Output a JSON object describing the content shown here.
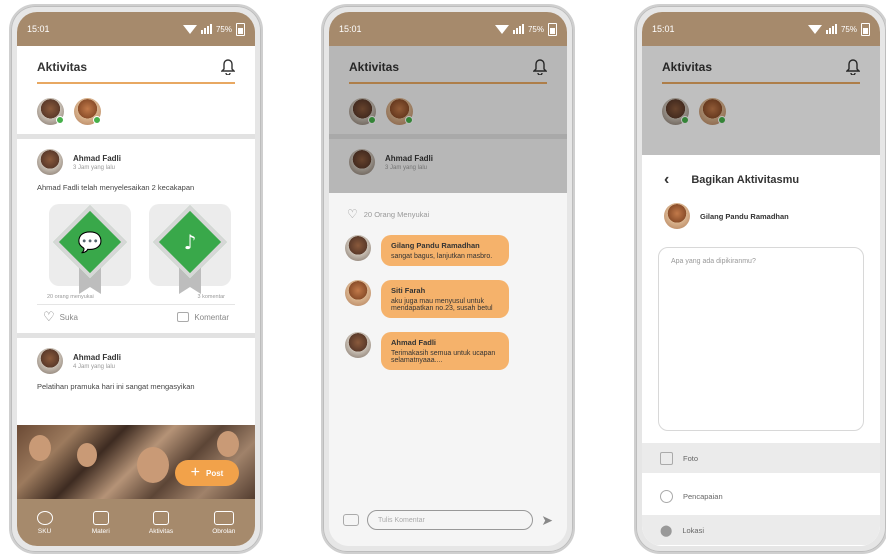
{
  "status": {
    "time": "15:01",
    "battery": "75%"
  },
  "phone1": {
    "title": "Aktivitas",
    "post1": {
      "name": "Ahmad Fadli",
      "time": "3 Jam yang lalu",
      "text": "Ahmad Fadli telah menyelesaikan 2 kecakapan",
      "likes": "20 orang menyukai",
      "comments": "3 komentar"
    },
    "actions": {
      "like": "Suka",
      "comment": "Komentar"
    },
    "post2": {
      "name": "Ahmad Fadli",
      "time": "4 Jam yang lalu",
      "text": "Pelatihan pramuka hari ini sangat mengasyikan"
    },
    "post_button": "Post",
    "nav": [
      "SKU",
      "Materi",
      "Aktivitas",
      "Obrolan"
    ]
  },
  "phone2": {
    "title": "Aktivitas",
    "poster": {
      "name": "Ahmad Fadli",
      "time": "3 Jam yang lalu"
    },
    "likes": "20 Orang Menyukai",
    "comments": [
      {
        "name": "Gilang Pandu Ramadhan",
        "text": "sangat bagus, lanjutkan masbro."
      },
      {
        "name": "Siti Farah",
        "text": "aku juga mau menyusul untuk mendapatkan no.23, susah betul"
      },
      {
        "name": "Ahmad Fadli",
        "text": "Terimakasih semua untuk ucapan selamatnyaaa...."
      }
    ],
    "input_placeholder": "Tulis Komentar"
  },
  "phone3": {
    "title": "Aktivitas",
    "sheet_title": "Bagikan Aktivitasmu",
    "user": "Gilang Pandu Ramadhan",
    "placeholder": "Apa yang ada dipikiranmu?",
    "options": [
      "Foto",
      "Pencapaian",
      "Lokasi"
    ]
  },
  "colors": {
    "brand": "#a68a6c",
    "accent": "#f2a24a",
    "bubble": "#f5b26b",
    "badge": "#39a84a"
  }
}
